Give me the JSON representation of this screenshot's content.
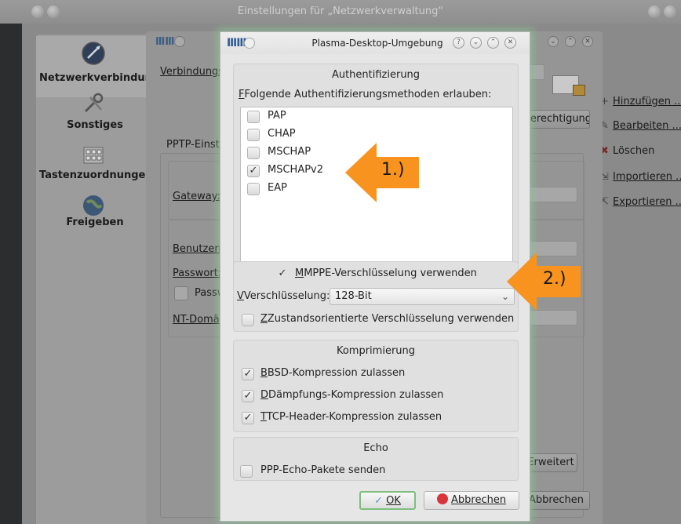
{
  "main_window": {
    "title": "Einstellungen für „Netzwerkverwaltung“",
    "sidebar": [
      {
        "label": "Netzwerkverbindungen",
        "icon": "network-globe-icon"
      },
      {
        "label": "Sonstiges",
        "icon": "tools-icon"
      },
      {
        "label": "Tastenzuordnungen",
        "icon": "keyboard-icon"
      },
      {
        "label": "Freigeben",
        "icon": "globe-icon"
      }
    ],
    "buttons": [
      {
        "label": "Hinzufügen ...",
        "icon": "add-icon"
      },
      {
        "label": "Bearbeiten ...",
        "icon": "edit-icon"
      },
      {
        "label": "Löschen",
        "icon": "delete-icon"
      },
      {
        "label": "Importieren ...",
        "icon": "import-icon"
      },
      {
        "label": "Exportieren ...",
        "icon": "export-icon"
      }
    ]
  },
  "middle_dialog": {
    "connection_label": "Verbindungsname:",
    "permissions_button": "Berechtigungen",
    "tab_label": "PPTP-Einstellungen",
    "gateway_label": "Gateway:",
    "user_label": "Benutzername:",
    "password_label": "Passwort:",
    "show_password_label": "Passwort anzeigen",
    "nt_domain_label": "NT-Domäne:",
    "advanced_button": "Erweitert",
    "cancel_button": "Abbrechen"
  },
  "dialog": {
    "title": "Plasma-Desktop-Umgebung",
    "auth": {
      "title": "Authentifizierung",
      "label": "Folgende Authentifizierungsmethoden erlauben:",
      "methods": [
        {
          "label": "PAP",
          "checked": false
        },
        {
          "label": "CHAP",
          "checked": false
        },
        {
          "label": "MSCHAP",
          "checked": false
        },
        {
          "label": "MSCHAPv2",
          "checked": true
        },
        {
          "label": "EAP",
          "checked": false
        }
      ]
    },
    "mppe": {
      "label": "MPPE-Verschlüsselung verwenden",
      "checked": true,
      "encryption_label": "Verschlüsselung:",
      "encryption_value": "128-Bit",
      "stateful_label": "Zustandsorientierte Verschlüsselung verwenden",
      "stateful_checked": false
    },
    "compression": {
      "title": "Komprimierung",
      "items": [
        {
          "label": "BSD-Kompression zulassen",
          "checked": true
        },
        {
          "label": "Dämpfungs-Kompression zulassen",
          "checked": true
        },
        {
          "label": "TCP-Header-Kompression zulassen",
          "checked": true
        }
      ]
    },
    "echo": {
      "title": "Echo",
      "label": "PPP-Echo-Pakete senden",
      "checked": false
    },
    "ok_button": "OK",
    "cancel_button": "Abbrechen"
  },
  "annotations": [
    "1.)",
    "2.)"
  ],
  "colors": {
    "arrow": "#f7931e",
    "dialog_glow": "#8cc396",
    "cancel_icon": "#d9343a",
    "ok_icon": "#6a93c9"
  },
  "check_mark": "✓"
}
